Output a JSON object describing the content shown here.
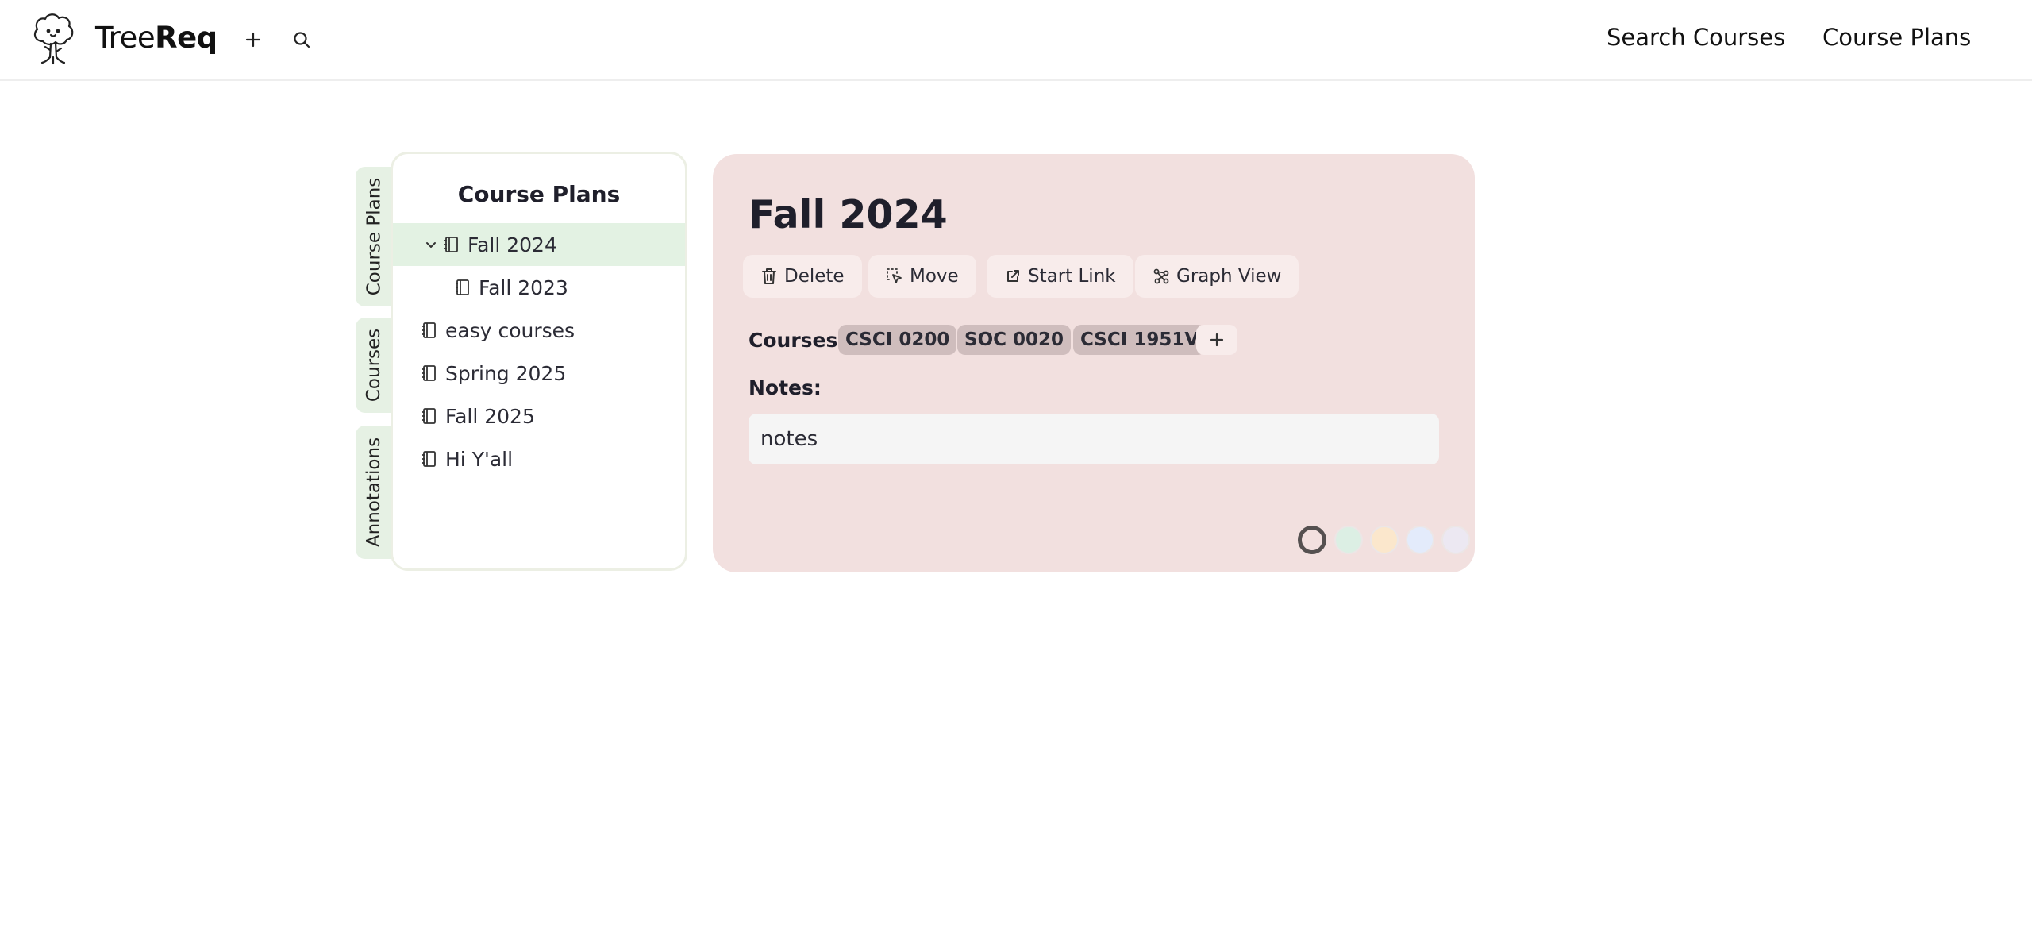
{
  "header": {
    "brand_light": "Tree",
    "brand_bold": "Req",
    "nav_links": [
      "Search Courses",
      "Course Plans"
    ]
  },
  "side_tabs": [
    "Course Plans",
    "Courses",
    "Annotations"
  ],
  "plans_panel": {
    "title": "Course Plans",
    "items": [
      {
        "label": "Fall 2024",
        "selected": true,
        "expanded": true
      },
      {
        "label": "Fall 2023",
        "child": true
      },
      {
        "label": "easy courses"
      },
      {
        "label": "Spring 2025"
      },
      {
        "label": "Fall 2025"
      },
      {
        "label": "Hi Y'all"
      }
    ]
  },
  "detail": {
    "title": "Fall 2024",
    "actions": [
      "Delete",
      "Move",
      "Start Link",
      "Graph View"
    ],
    "courses_label": "Courses:",
    "courses": [
      "CSCI 0200",
      "SOC 0020",
      "CSCI 1951V"
    ],
    "notes_label": "Notes:",
    "notes_value": "notes",
    "colors": {
      "card_background": "#f2e0df",
      "swatches": [
        "#f2e0df",
        "#dcefe4",
        "#fbe7cc",
        "#e3ebfb",
        "#ece8f2"
      ],
      "selected_swatch": 0
    }
  }
}
